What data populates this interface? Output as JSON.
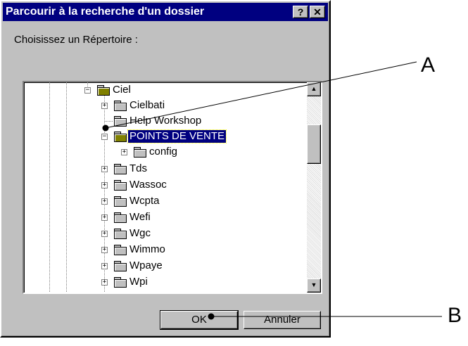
{
  "dialog": {
    "title": "Parcourir à la recherche d'un dossier",
    "help_label": "?",
    "close_label": "✕",
    "prompt": "Choisissez un Répertoire :"
  },
  "tree": {
    "root": "Ciel",
    "items": [
      {
        "label": "Cielbati",
        "expandable": true
      },
      {
        "label": "Help Workshop",
        "expandable": false
      },
      {
        "label": "POINTS DE VENTE",
        "expandable": true,
        "expanded": true,
        "selected": true
      },
      {
        "label": "config",
        "expandable": true,
        "child": true
      },
      {
        "label": "Tds",
        "expandable": true
      },
      {
        "label": "Wassoc",
        "expandable": true
      },
      {
        "label": "Wcpta",
        "expandable": true
      },
      {
        "label": "Wefi",
        "expandable": true
      },
      {
        "label": "Wgc",
        "expandable": true
      },
      {
        "label": "Wimmo",
        "expandable": true
      },
      {
        "label": "Wpaye",
        "expandable": true
      },
      {
        "label": "Wpi",
        "expandable": true
      }
    ]
  },
  "buttons": {
    "ok": "OK",
    "cancel": "Annuler"
  },
  "annotations": {
    "a": "A",
    "b": "B"
  },
  "icons": {
    "up_arrow": "▲",
    "down_arrow": "▼",
    "plus": "+",
    "minus": "−"
  }
}
